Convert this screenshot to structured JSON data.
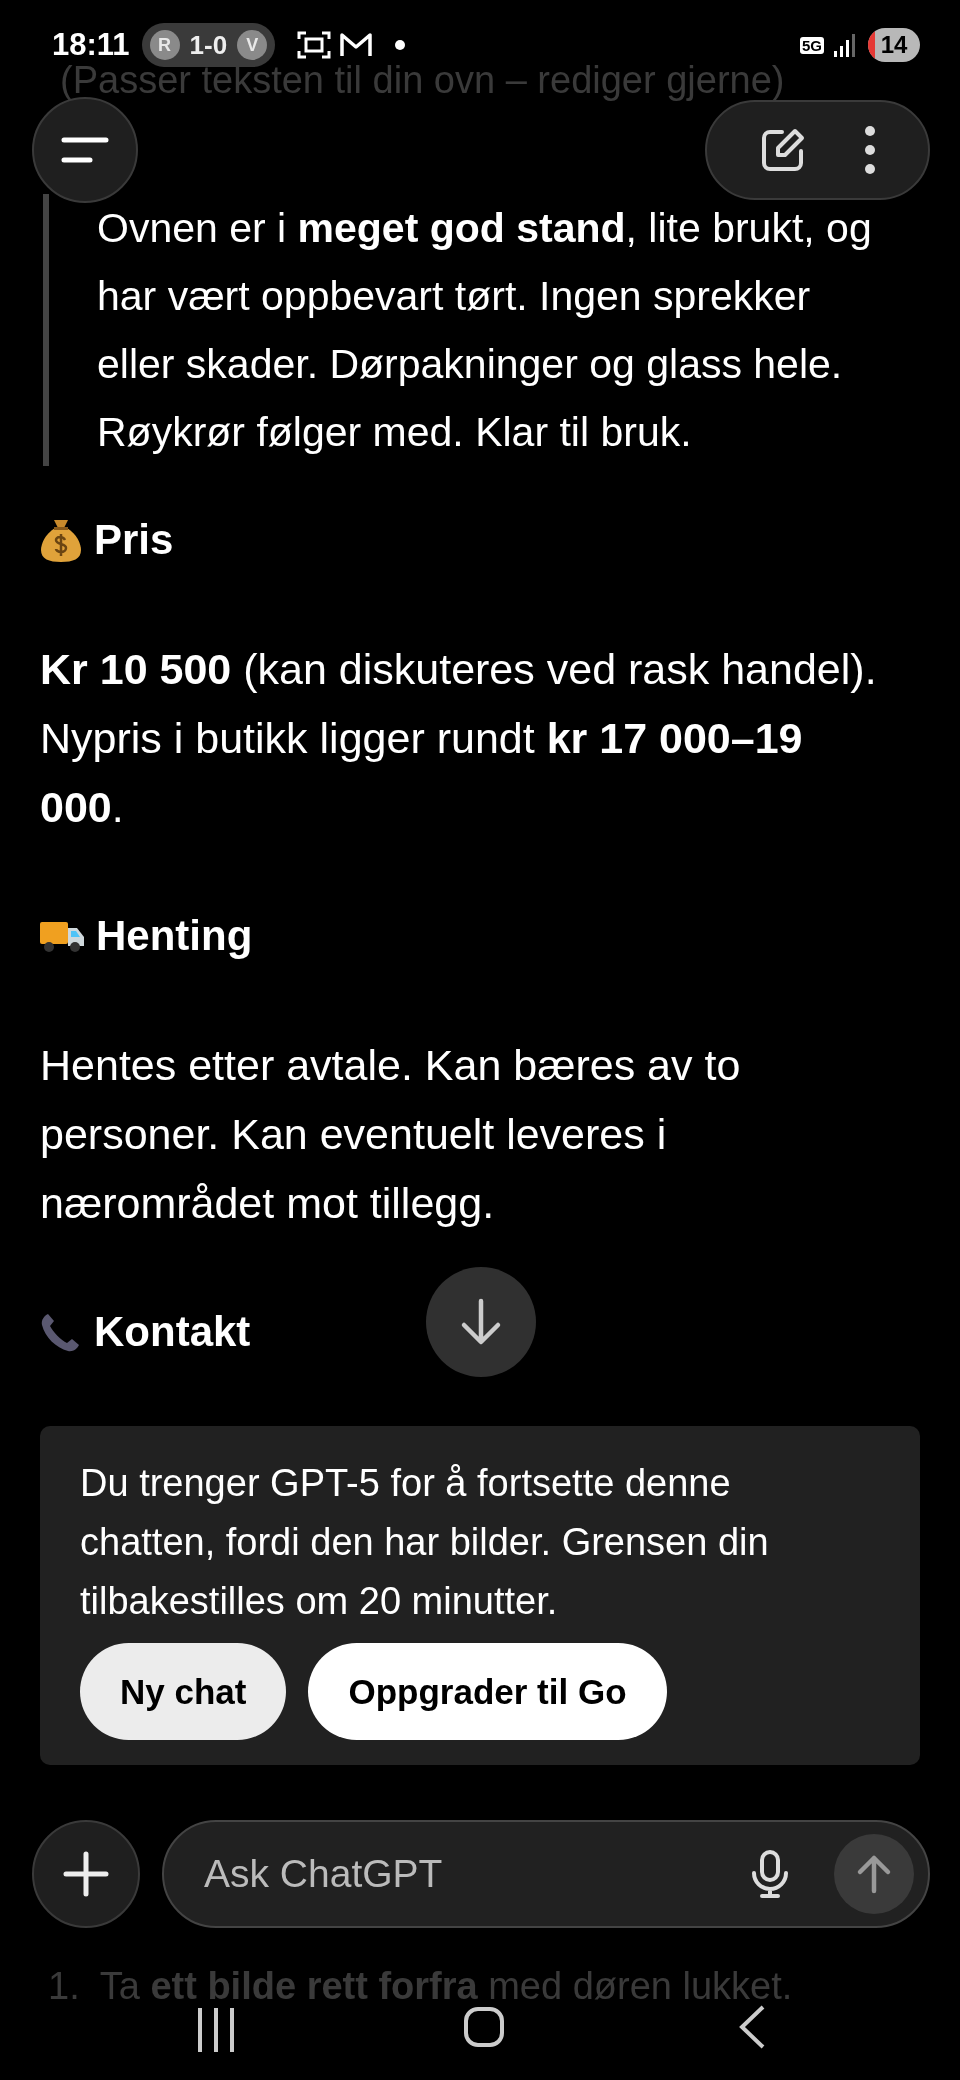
{
  "status_bar": {
    "time": "18:11",
    "score_pill": {
      "home": "R",
      "score": "1-0",
      "away": "V"
    },
    "network": "5G",
    "battery": "14"
  },
  "faded_top_line": "(Passer teksten til din ovn – rediger gjerne)",
  "quote": "Ovnen er i **meget god stand**, lite brukt, og har vært oppbevart tørt. Ingen sprekker eller skader. Dørpakninger og glass hele. Røykrør følger med. Klar til bruk.",
  "sections": [
    {
      "kind": "price",
      "heading": "Pris",
      "body": "**Kr 10 500** (kan diskuteres ved rask handel). Nypris i butikk ligger rundt **kr 17 000–19 000**."
    },
    {
      "kind": "pickup",
      "heading": "Henting",
      "body": "Hentes etter avtale. Kan bæres av to personer. Kan eventuelt leveres i nærområdet mot tillegg."
    },
    {
      "kind": "contact",
      "heading": "Kontakt"
    }
  ],
  "limit_notice": {
    "text": "Du trenger GPT-5 for å fortsette denne chatten, fordi den har bilder. Grensen din tilbakestilles om 20 minutter.",
    "buttons": [
      {
        "label": "Ny chat",
        "kind": "secondary"
      },
      {
        "label": "Oppgrader til Go",
        "kind": "primary"
      }
    ]
  },
  "composer": {
    "placeholder": "Ask ChatGPT"
  },
  "faded_list_item": {
    "number": "1.",
    "text": "Ta **ett bilde rett forfra** med døren lukket."
  }
}
